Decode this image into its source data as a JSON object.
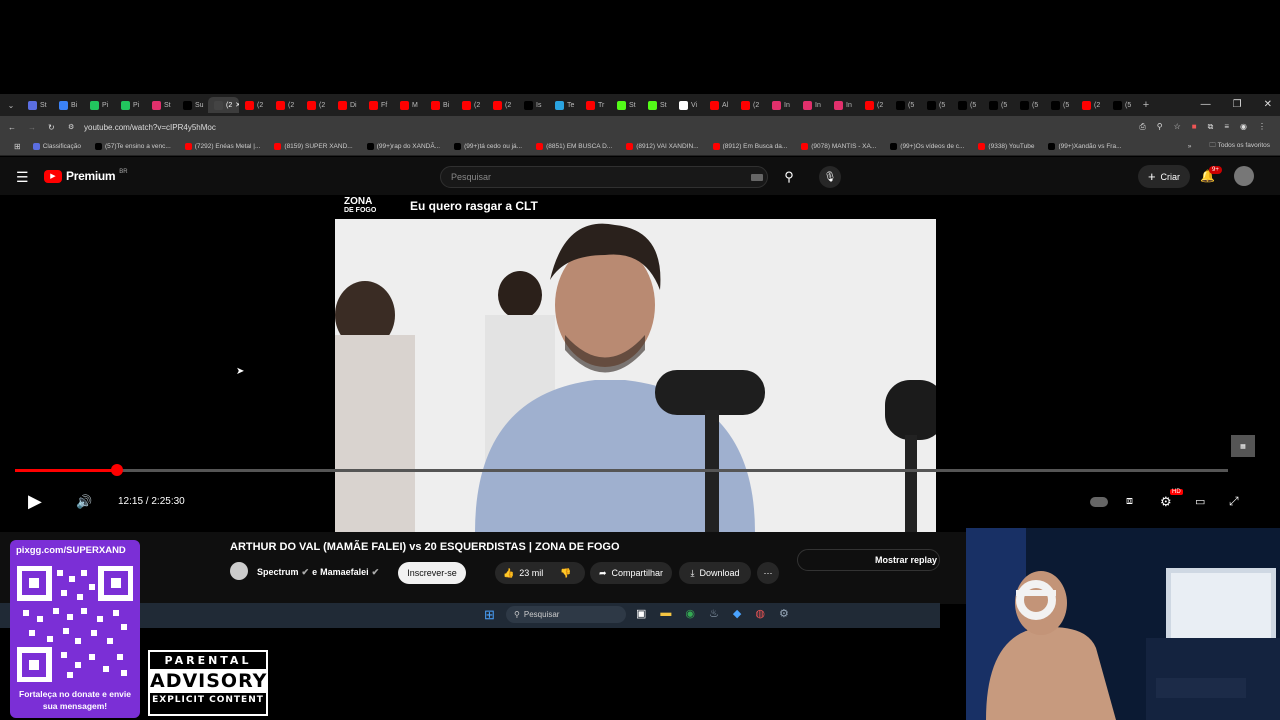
{
  "browser": {
    "url": "youtube.com/watch?v=cIPR4y5hMoc",
    "active_tab_label": "(2",
    "tabs": [
      {
        "label": "St",
        "color": "#5b6ee1"
      },
      {
        "label": "Bi",
        "color": "#3b82f6"
      },
      {
        "label": "Pi",
        "color": "#22c55e"
      },
      {
        "label": "Pi",
        "color": "#22c55e"
      },
      {
        "label": "St",
        "color": "#e1306c"
      },
      {
        "label": "Su",
        "color": "#000000"
      },
      {
        "label": "(2",
        "color": "#444444"
      },
      {
        "label": "(2",
        "color": "#ff0000"
      },
      {
        "label": "(2",
        "color": "#ff0000"
      },
      {
        "label": "(2",
        "color": "#ff0000"
      },
      {
        "label": "Di",
        "color": "#ff0000"
      },
      {
        "label": "Ff",
        "color": "#ff0000"
      },
      {
        "label": "M",
        "color": "#ff0000"
      },
      {
        "label": "Bi",
        "color": "#ff0000"
      },
      {
        "label": "(2",
        "color": "#ff0000"
      },
      {
        "label": "(2",
        "color": "#ff0000"
      },
      {
        "label": "Is",
        "color": "#000000"
      },
      {
        "label": "Te",
        "color": "#2aa3e0"
      },
      {
        "label": "Tr",
        "color": "#ff0000"
      },
      {
        "label": "St",
        "color": "#53fc18"
      },
      {
        "label": "St",
        "color": "#53fc18"
      },
      {
        "label": "Vi",
        "color": "#ffffff"
      },
      {
        "label": "Al",
        "color": "#ff0000"
      },
      {
        "label": "(2",
        "color": "#ff0000"
      },
      {
        "label": "In",
        "color": "#e1306c"
      },
      {
        "label": "In",
        "color": "#e1306c"
      },
      {
        "label": "In",
        "color": "#e1306c"
      },
      {
        "label": "(2",
        "color": "#ff0000"
      },
      {
        "label": "(5",
        "color": "#000000"
      },
      {
        "label": "(5",
        "color": "#000000"
      },
      {
        "label": "(5",
        "color": "#000000"
      },
      {
        "label": "(5",
        "color": "#000000"
      },
      {
        "label": "(5",
        "color": "#000000"
      },
      {
        "label": "(5",
        "color": "#000000"
      },
      {
        "label": "(2",
        "color": "#ff0000"
      },
      {
        "label": "(5",
        "color": "#000000"
      }
    ],
    "bookmarks": [
      {
        "label": "Classificação",
        "color": "#5b6ee1"
      },
      {
        "label": "(57)Te ensino a venc...",
        "color": "#000000"
      },
      {
        "label": "(7292) Enéas Metal |...",
        "color": "#ff0000"
      },
      {
        "label": "(8159) SUPER XAND...",
        "color": "#ff0000"
      },
      {
        "label": "(99+)rap do XANDÃ...",
        "color": "#000000"
      },
      {
        "label": "(99+)tá cedo ou já...",
        "color": "#000000"
      },
      {
        "label": "(8851) EM BUSCA D...",
        "color": "#ff0000"
      },
      {
        "label": "(8912) VAI XANDIN...",
        "color": "#ff0000"
      },
      {
        "label": "(8912) Em Busca da...",
        "color": "#ff0000"
      },
      {
        "label": "(9078) MANTIS - XA...",
        "color": "#ff0000"
      },
      {
        "label": "(99+)Os vídeos de c...",
        "color": "#000000"
      },
      {
        "label": "(9338) YouTube",
        "color": "#ff0000"
      },
      {
        "label": "(99+)Xandão vs Fra...",
        "color": "#000000"
      }
    ],
    "all_bookmarks_label": "Todos os favoritos"
  },
  "youtube": {
    "logo_text": "Premium",
    "logo_region": "BR",
    "search_placeholder": "Pesquisar",
    "create_label": "Criar",
    "notif_badge": "9+"
  },
  "video": {
    "overlay_brand_line1": "ZONA",
    "overlay_brand_line2": "DE FOGO",
    "overlay_headline": "Eu quero rasgar a CLT",
    "time_display": "12:15 / 2:25:30",
    "progress_fraction": 0.0841,
    "settings_badge": "HD",
    "title": "ARTHUR DO VAL (MAMÃE FALEI) vs 20 ESQUERDISTAS | ZONA DE FOGO",
    "channel": "Spectrum",
    "channel_sep": "e",
    "channel2": "Mamaefalei",
    "subscribe_label": "Inscrever-se",
    "likes": "23 mil",
    "share_label": "Compartilhar",
    "download_label": "Download",
    "replay_label": "Mostrar replay d"
  },
  "taskbar": {
    "search_placeholder": "Pesquisar"
  },
  "stream_overlay": {
    "pix_url": "pixgg.com/SUPERXAND",
    "donate_text": "Fortaleça no donate e envie sua mensagem!",
    "advisory_line1": "PARENTAL",
    "advisory_line2": "ADVISORY",
    "advisory_line3": "EXPLICIT CONTENT"
  },
  "colors": {
    "youtube_red": "#ff0000",
    "pix_purple": "#7b2fd6",
    "chrome_dark": "#3c3c3c"
  }
}
